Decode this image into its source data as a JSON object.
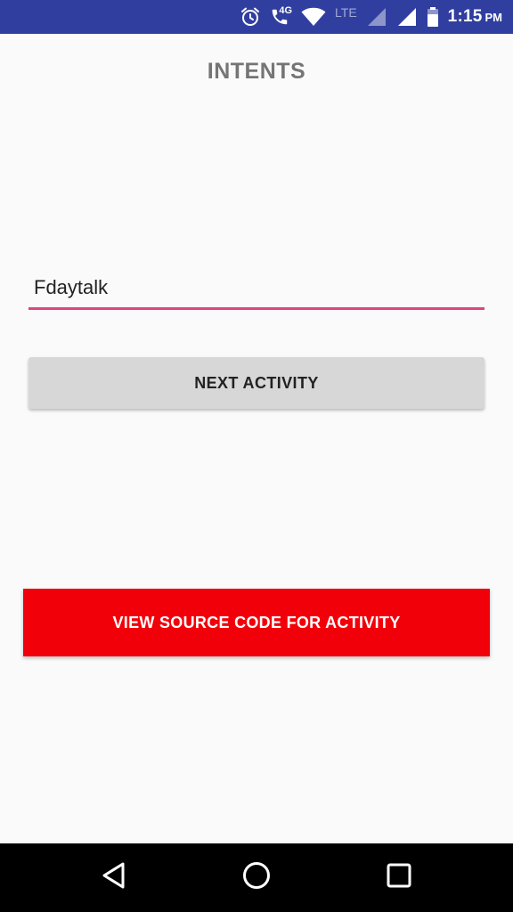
{
  "status_bar": {
    "network_label": "4G",
    "lte_label": "LTE",
    "time": "1:15",
    "ampm": "PM",
    "icons": [
      "alarm-icon",
      "call-4g-icon",
      "wifi-icon",
      "signal-icon",
      "signal-icon",
      "battery-icon"
    ]
  },
  "header": {
    "title": "INTENTS"
  },
  "form": {
    "name_value": "Fdaytalk",
    "next_button_label": "NEXT ACTIVITY"
  },
  "footer_action": {
    "source_button_label": "VIEW SOURCE CODE FOR ACTIVITY"
  },
  "nav_bar": {
    "icons": [
      "back-icon",
      "home-icon",
      "recents-icon"
    ]
  },
  "colors": {
    "status_bar": "#303f9f",
    "background": "#fafafa",
    "accent_underline": "#e0447a",
    "source_button": "#f20009",
    "next_button": "#d7d7d7"
  }
}
